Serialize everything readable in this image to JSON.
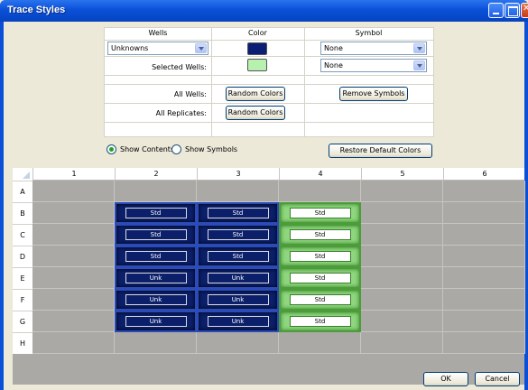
{
  "window": {
    "title": "Trace Styles"
  },
  "config": {
    "headers": {
      "wells": "Wells",
      "color": "Color",
      "symbol": "Symbol"
    },
    "wells_select": {
      "value": "Unknowns"
    },
    "wells_color": "#0a1f74",
    "wells_symbol": {
      "value": "None"
    },
    "selected_wells_label": "Selected Wells:",
    "selected_color": "#b8f0b0",
    "selected_symbol": {
      "value": "None"
    },
    "all_wells_label": "All Wells:",
    "all_replicates_label": "All Replicates:",
    "random_colors_label": "Random Colors",
    "random_colors_label_2": "Random Colors",
    "remove_symbols_label": "Remove Symbols",
    "restore_default_label": "Restore Default Colors",
    "show_contents_label": "Show Contents",
    "show_symbols_label": "Show Symbols",
    "show_mode": "contents"
  },
  "plate": {
    "columns": [
      "1",
      "2",
      "3",
      "4",
      "5",
      "6"
    ],
    "rows": [
      "A",
      "B",
      "C",
      "D",
      "E",
      "F",
      "G",
      "H"
    ],
    "cells": [
      [
        "",
        "",
        "",
        "",
        "",
        ""
      ],
      [
        "",
        "Std",
        "Std",
        "Std",
        "",
        ""
      ],
      [
        "",
        "Std",
        "Std",
        "Std",
        "",
        ""
      ],
      [
        "",
        "Std",
        "Std",
        "Std",
        "",
        ""
      ],
      [
        "",
        "Unk",
        "Unk",
        "Std",
        "",
        ""
      ],
      [
        "",
        "Unk",
        "Unk",
        "Std",
        "",
        ""
      ],
      [
        "",
        "Unk",
        "Unk",
        "Std",
        "",
        ""
      ],
      [
        "",
        "",
        "",
        "",
        "",
        ""
      ]
    ],
    "styles": [
      [
        "",
        "",
        "",
        "",
        "",
        ""
      ],
      [
        "",
        "blue",
        "blue",
        "green",
        "",
        ""
      ],
      [
        "",
        "blue",
        "blue",
        "green",
        "",
        ""
      ],
      [
        "",
        "blue",
        "blue",
        "green",
        "",
        ""
      ],
      [
        "",
        "blue",
        "blue",
        "green",
        "",
        ""
      ],
      [
        "",
        "blue",
        "blue",
        "green",
        "",
        ""
      ],
      [
        "",
        "blue",
        "blue",
        "green",
        "",
        ""
      ],
      [
        "",
        "",
        "",
        "",
        "",
        ""
      ]
    ]
  },
  "footer": {
    "ok_label": "OK",
    "cancel_label": "Cancel"
  }
}
